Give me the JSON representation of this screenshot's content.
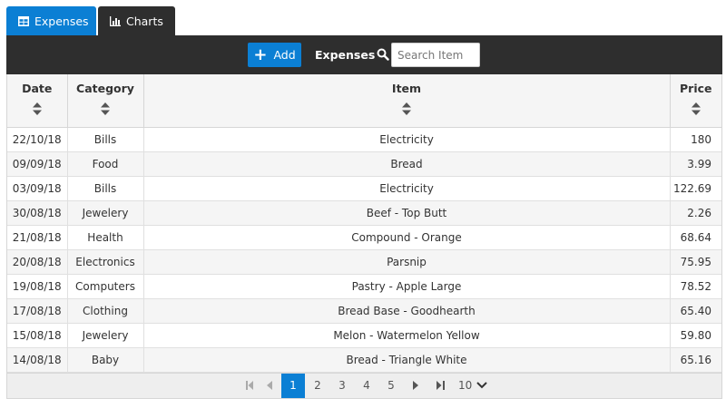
{
  "tabs": [
    {
      "label": "Expenses",
      "icon": "table-icon",
      "active": true
    },
    {
      "label": "Charts",
      "icon": "bar-chart-icon",
      "active": false
    }
  ],
  "toolbar": {
    "add_label": "Add",
    "title": "Expenses",
    "search_placeholder": "Search Item"
  },
  "columns": [
    "Date",
    "Category",
    "Item",
    "Price"
  ],
  "rows": [
    {
      "date": "22/10/18",
      "category": "Bills",
      "item": "Electricity",
      "price": "180"
    },
    {
      "date": "09/09/18",
      "category": "Food",
      "item": "Bread",
      "price": "3.99"
    },
    {
      "date": "03/09/18",
      "category": "Bills",
      "item": "Electricity",
      "price": "122.69"
    },
    {
      "date": "30/08/18",
      "category": "Jewelery",
      "item": "Beef - Top Butt",
      "price": "2.26"
    },
    {
      "date": "21/08/18",
      "category": "Health",
      "item": "Compound - Orange",
      "price": "68.64"
    },
    {
      "date": "20/08/18",
      "category": "Electronics",
      "item": "Parsnip",
      "price": "75.95"
    },
    {
      "date": "19/08/18",
      "category": "Computers",
      "item": "Pastry - Apple Large",
      "price": "78.52"
    },
    {
      "date": "17/08/18",
      "category": "Clothing",
      "item": "Bread Base - Goodhearth",
      "price": "65.40"
    },
    {
      "date": "15/08/18",
      "category": "Jewelery",
      "item": "Melon - Watermelon Yellow",
      "price": "59.80"
    },
    {
      "date": "14/08/18",
      "category": "Baby",
      "item": "Bread - Triangle White",
      "price": "65.16"
    }
  ],
  "pagination": {
    "pages": [
      "1",
      "2",
      "3",
      "4",
      "5"
    ],
    "current": "1",
    "page_size": "10"
  },
  "colors": {
    "accent": "#0b7fd4",
    "toolbar_bg": "#2e2e2e"
  }
}
